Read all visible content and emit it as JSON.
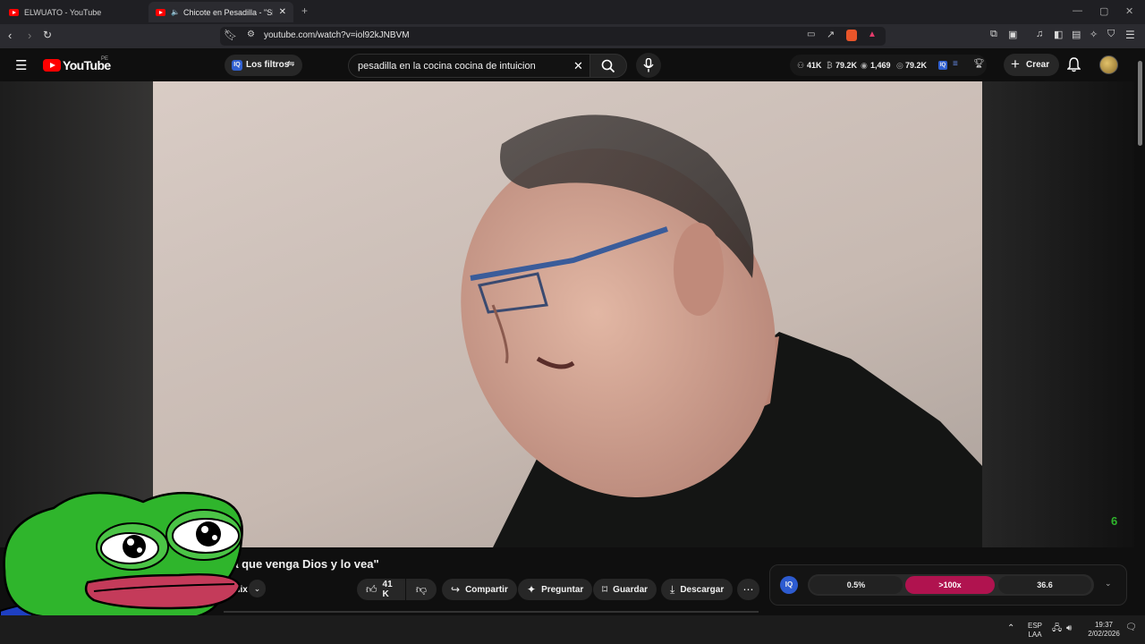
{
  "browser": {
    "tabs": [
      {
        "title": "ELWUATO - YouTube",
        "active": false
      },
      {
        "title": "Chicote en Pesadilla - \"Si est",
        "active": true
      }
    ],
    "url": "youtube.com/watch?v=iol92kJNBVM"
  },
  "youtube": {
    "region": "PE",
    "filters_label": "Los filtros",
    "search_value": "pesadilla en la cocina cocina de intuicion",
    "stats": [
      {
        "icon": "person-icon",
        "value": "41K"
      },
      {
        "icon": "views-icon",
        "value": "79.2K"
      },
      {
        "icon": "eye-icon",
        "value": "1,469"
      },
      {
        "icon": "watch-icon",
        "value": "79.2K"
      }
    ],
    "create_label": "Crear"
  },
  "video": {
    "title_visible": "ca que venga Dios y lo vea\"",
    "channel_fragment": "emix",
    "likes": "41 K",
    "actions": [
      "Compartir",
      "Preguntar",
      "Guardar",
      "Descargar"
    ]
  },
  "iq_panel": {
    "badge": "IQ",
    "values": [
      "0.5%",
      ">100x",
      "36.6"
    ],
    "accent": "#b0134f"
  },
  "taskbar": {
    "lang_top": "ESP",
    "lang_bottom": "LAA",
    "time": "19:37",
    "date": "2/02/2026"
  },
  "colors": {
    "yt_red": "#ff0000",
    "bg": "#0f0f0f",
    "pepe_green": "#2fb52c"
  }
}
